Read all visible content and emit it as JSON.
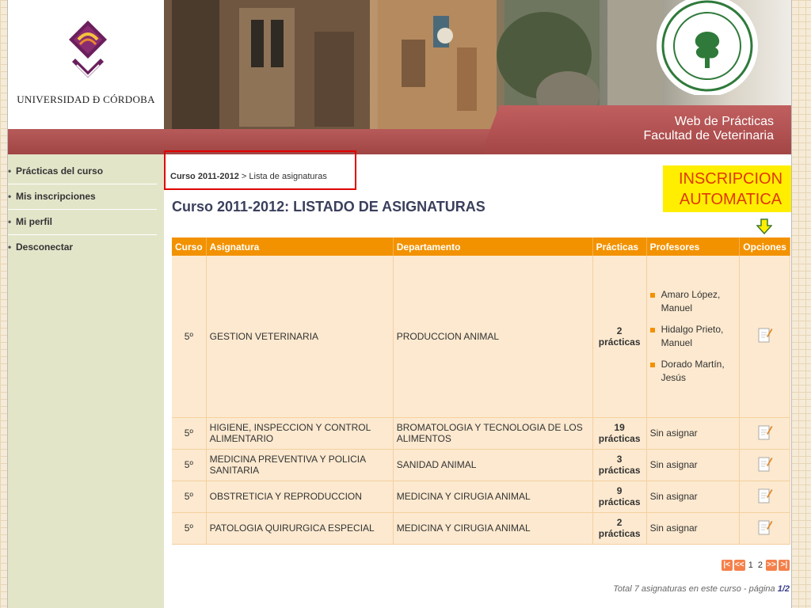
{
  "header": {
    "logo_text": "UNIVERSIDAD Ð CÓRDOBA",
    "site_title_line1": "Web de Prácticas",
    "site_title_line2": "Facultad de Veterinaria"
  },
  "sidebar": {
    "items": [
      {
        "label": "Prácticas del curso"
      },
      {
        "label": "Mis inscripciones"
      },
      {
        "label": "Mi perfil"
      },
      {
        "label": "Desconectar"
      }
    ]
  },
  "breadcrumb": {
    "course": "Curso 2011-2012",
    "rest": " > Lista de asignaturas"
  },
  "page_title": "Curso 2011-2012: LISTADO DE ASIGNATURAS",
  "callout": {
    "line1": "INSCRIPCION",
    "line2": "AUTOMATICA"
  },
  "table": {
    "headers": [
      "Curso",
      "Asignatura",
      "Departamento",
      "Prácticas",
      "Profesores",
      "Opciones"
    ],
    "rows": [
      {
        "curso": "5º",
        "asignatura": "GESTION VETERINARIA",
        "departamento": "PRODUCCION ANIMAL",
        "practicas": "2 prácticas",
        "profesores": [
          "Amaro López, Manuel",
          "Hidalgo Prieto, Manuel",
          "Dorado Martín, Jesús"
        ]
      },
      {
        "curso": "5º",
        "asignatura": "HIGIENE, INSPECCION Y CONTROL ALIMENTARIO",
        "departamento": "BROMATOLOGIA Y TECNOLOGIA DE LOS ALIMENTOS",
        "practicas": "19 prácticas",
        "profesores_text": "Sin asignar"
      },
      {
        "curso": "5º",
        "asignatura": "MEDICINA PREVENTIVA Y POLICIA SANITARIA",
        "departamento": "SANIDAD ANIMAL",
        "practicas": "3 prácticas",
        "profesores_text": "Sin asignar"
      },
      {
        "curso": "5º",
        "asignatura": "OBSTRETICIA Y REPRODUCCION",
        "departamento": "MEDICINA Y CIRUGIA ANIMAL",
        "practicas": "9 prácticas",
        "profesores_text": "Sin asignar"
      },
      {
        "curso": "5º",
        "asignatura": "PATOLOGIA QUIRURGICA ESPECIAL",
        "departamento": "MEDICINA Y CIRUGIA ANIMAL",
        "practicas": "2 prácticas",
        "profesores_text": "Sin asignar"
      }
    ]
  },
  "pager": {
    "first": "|<",
    "prev": "<<",
    "page1": "1",
    "page2": "2",
    "next": ">>",
    "last": ">|"
  },
  "footer": {
    "total_text": "Total 7 asignaturas en este curso - página ",
    "page_indicator": "1/2"
  },
  "colors": {
    "accent": "#f29200",
    "banner": "#a94b4b",
    "sidebar": "#e3e5c9",
    "row": "#fce9cf",
    "highlight": "#e00000"
  }
}
